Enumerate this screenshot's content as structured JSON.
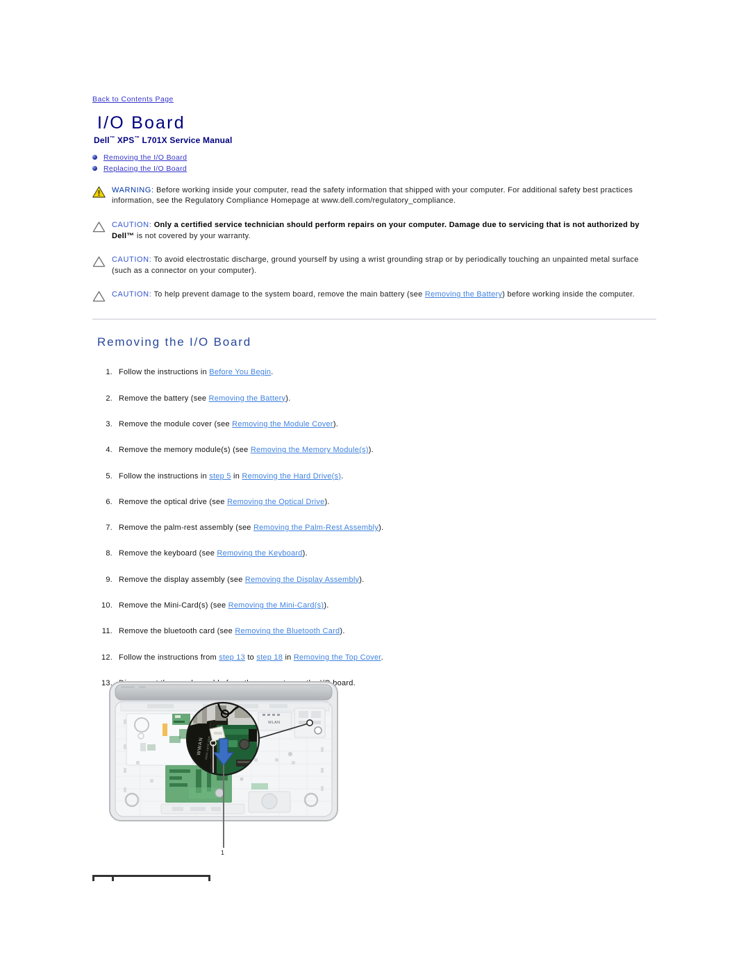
{
  "back_link": "Back to Contents Page",
  "title": "I/O Board",
  "subtitle_parts": {
    "brand": "Dell",
    "tm1": "™",
    "line": " XPS",
    "tm2": "™",
    "model": " L701X Service Manual"
  },
  "subtitle_full": "Dell™ XPS™ L701X Service Manual",
  "toc": [
    {
      "label": "Removing the I/O Board"
    },
    {
      "label": "Replacing the I/O Board"
    }
  ],
  "admonitions": [
    {
      "icon": "warning-triangle-icon",
      "label": "WARNING:",
      "text": " Before working inside your computer, read the safety information that shipped with your computer. For additional safety best practices information, see the Regulatory Compliance Homepage at www.dell.com/regulatory_compliance."
    },
    {
      "icon": "caution-triangle-icon",
      "label": "CAUTION:",
      "bold_text": " Only a certified service technician should perform repairs on your computer. Damage due to servicing that is not authorized by Dell™",
      "text": " is not covered by your warranty."
    },
    {
      "icon": "caution-triangle-icon",
      "label": "CAUTION:",
      "text": " To avoid electrostatic discharge, ground yourself by using a wrist grounding strap or by periodically touching an unpainted metal surface (such as a connector on your computer)."
    },
    {
      "icon": "caution-triangle-icon",
      "label": "CAUTION:",
      "text_before": " To help prevent damage to the system board, remove the main battery (see ",
      "link": "Removing the Battery",
      "text_after": ") before working inside the computer."
    }
  ],
  "section_heading": "Removing the I/O Board",
  "steps": [
    {
      "num": "1.",
      "before": "Follow the instructions in ",
      "link": "Before You Begin",
      "after": "."
    },
    {
      "num": "2.",
      "before": "Remove the battery (see ",
      "link": "Removing the Battery",
      "after": ")."
    },
    {
      "num": "3.",
      "before": "Remove the module cover (see ",
      "link": "Removing the Module Cover",
      "after": ")."
    },
    {
      "num": "4.",
      "before": "Remove the memory module(s) (see ",
      "link": "Removing the Memory Module(s)",
      "after": ")."
    },
    {
      "num": "5.",
      "before": "Follow the instructions in ",
      "link": "step 5",
      "mid": " in ",
      "link2": "Removing the Hard Drive(s)",
      "after": "."
    },
    {
      "num": "6.",
      "before": "Remove the optical drive (see ",
      "link": "Removing the Optical Drive",
      "after": ")."
    },
    {
      "num": "7.",
      "before": "Remove the palm-rest assembly (see ",
      "link": "Removing the Palm-Rest Assembly",
      "after": ")."
    },
    {
      "num": "8.",
      "before": "Remove the keyboard (see ",
      "link": "Removing the Keyboard",
      "after": ")."
    },
    {
      "num": "9.",
      "before": "Remove the display assembly (see ",
      "link": "Removing the Display Assembly",
      "after": ")."
    },
    {
      "num": "10.",
      "before": "Remove the Mini-Card(s) (see ",
      "link": "Removing the Mini-Card(s)",
      "after": ")."
    },
    {
      "num": "11.",
      "before": "Remove the bluetooth card (see ",
      "link": "Removing the Bluetooth Card",
      "after": ")."
    },
    {
      "num": "12.",
      "before": "Follow the instructions from ",
      "link": "step 13",
      "mid": " to ",
      "link2": "step 18",
      "mid2": " in ",
      "link3": "Removing the Top Cover",
      "after": "."
    },
    {
      "num": "13.",
      "before": "Disconnect the speaker cable from the connector on the I/O board.",
      "link": "",
      "after": ""
    }
  ],
  "figure": {
    "name": "laptop-base-io-board-photo",
    "callout_number": "1",
    "labels_in_photo": [
      "WLAN",
      "WWAN"
    ],
    "arrow_color": "#3b6fc4"
  },
  "legend_table": {
    "columns": 2,
    "rows": []
  },
  "colors": {
    "title_navy": "#000080",
    "section_heading_blue": "#28489c",
    "link_blue": "#3f82e0",
    "toc_link_blue": "#3333cc",
    "warning_yellow": "#f5d300",
    "rule_grey": "#cdd0d4"
  }
}
